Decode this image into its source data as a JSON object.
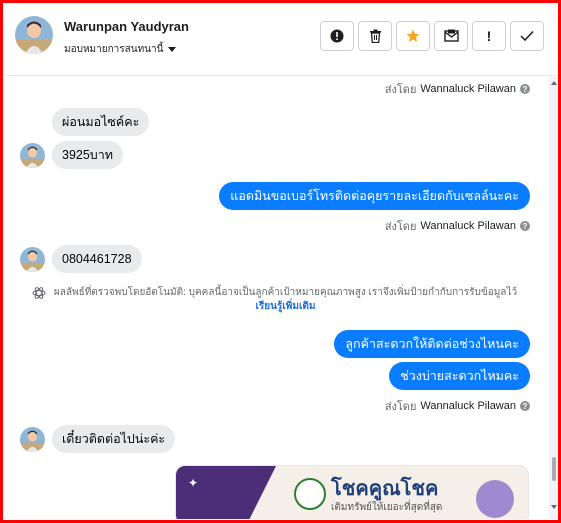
{
  "header": {
    "name": "Warunpan Yaudyran",
    "assign_label": "มอบหมายการสนทนานี้",
    "actions": [
      {
        "name": "alert",
        "glyph": "!"
      },
      {
        "name": "trash",
        "glyph": "🗑"
      },
      {
        "name": "star",
        "glyph": "★"
      },
      {
        "name": "mail",
        "glyph": "✉"
      },
      {
        "name": "exclaim",
        "glyph": "!"
      },
      {
        "name": "check",
        "glyph": "✓"
      }
    ]
  },
  "chat": {
    "sent_by_prefix": "ส่งโดย",
    "sent_by_name": "Wannaluck Pilawan",
    "help_glyph": "?",
    "messages": {
      "in1": "ผ่อนมอไซค์คะ",
      "in2": "3925บาท",
      "out1": "แอดมินขอเบอร์โทรติดต่อคุยรายละเอียดกับเซลล์นะคะ",
      "in3": "0804461728",
      "out2": "ลูกค้าสะดวกให้ติดต่อช่วงไหนคะ",
      "out3": "ช่วงบ่ายสะดวกไหมคะ",
      "in4": "เดี๋ยวติดต่อไปน่ะค่ะ"
    },
    "auto_detect": {
      "text": "ผลลัพธ์ที่ตรวจพบโดยอัตโนมัติ: บุคคลนี้อาจเป็นลูกค้าเป้าหมายคุณภาพสูง เราจึงเพิ่มป้ายกำกับการรับข้อมูลไว้",
      "link": "เรียนรู้เพิ่มเติม"
    },
    "card": {
      "title": "โชคคูณโชค",
      "subtitle": "เติมทรัพย์ให้เยอะที่สุดที่สุด"
    }
  },
  "colors": {
    "accent": "#0a7cff",
    "frame": "#ff0000",
    "incoming": "#e9eaec"
  }
}
